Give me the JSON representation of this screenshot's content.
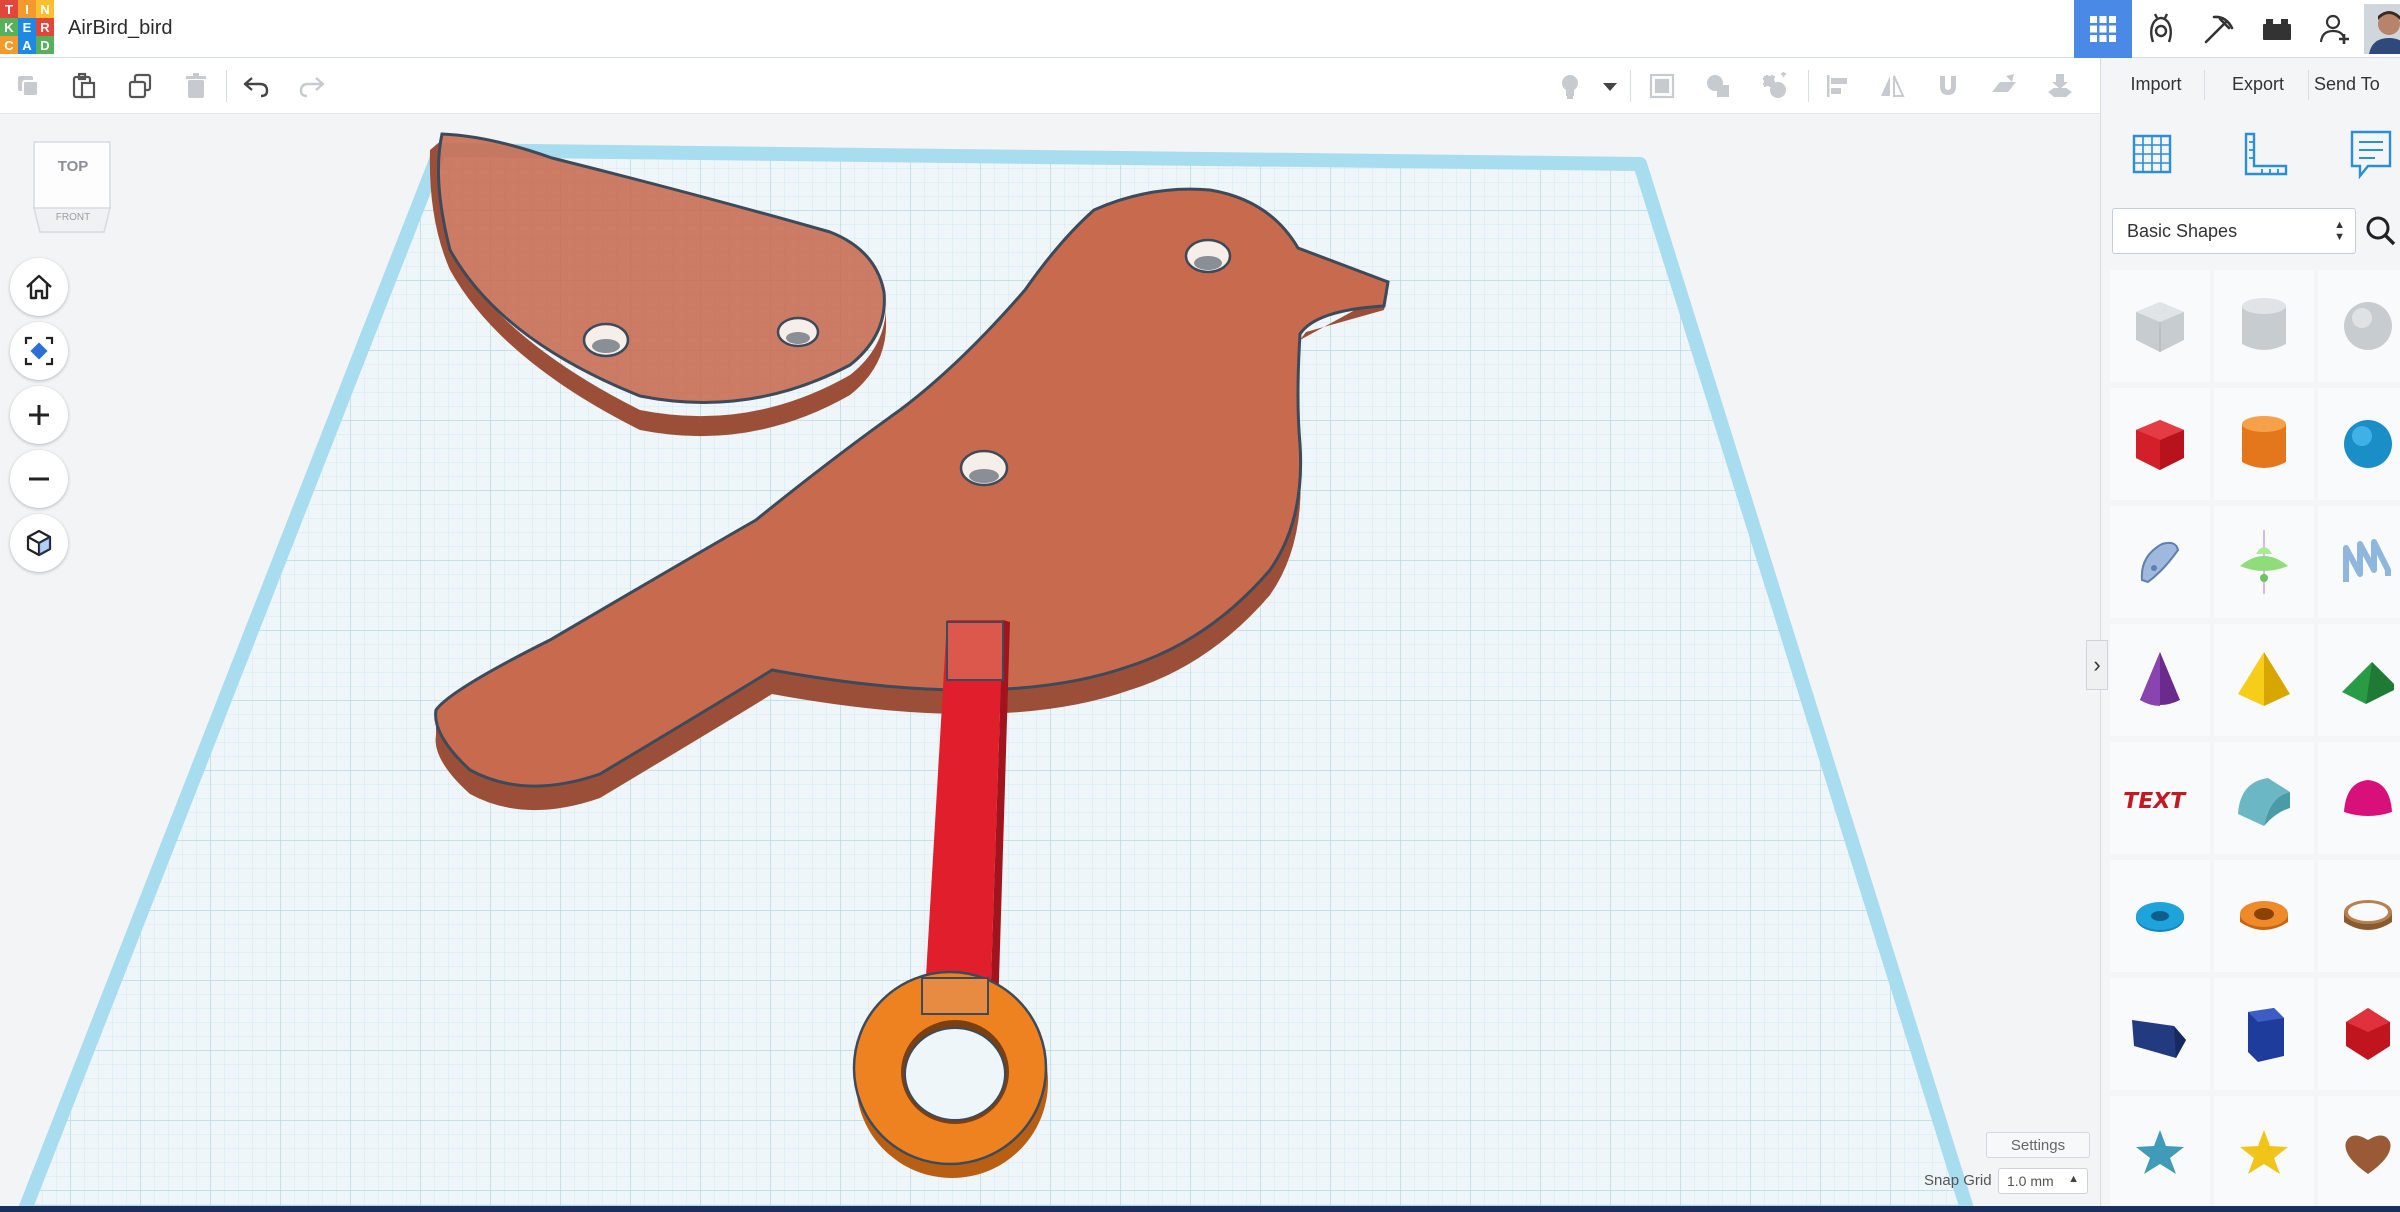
{
  "app": {
    "logo_letters": [
      "T",
      "I",
      "N",
      "K",
      "E",
      "R",
      "C",
      "A",
      "D"
    ],
    "logo_colors": [
      "#e2463a",
      "#f29a2e",
      "#fbc02d",
      "#57b05a",
      "#1e88e5",
      "#e2463a",
      "#f29a2e",
      "#1e88e5",
      "#57b05a"
    ],
    "project_title": "AirBird_bird"
  },
  "top_nav": {
    "icons": [
      "grid-view-icon",
      "tinker-gear-icon",
      "pickaxe-icon",
      "blocks-icon",
      "add-user-icon",
      "avatar"
    ],
    "active_color": "#4a8ae6"
  },
  "toolbar": {
    "left_icons": [
      "copy-icon",
      "paste-icon",
      "duplicate-icon",
      "delete-icon",
      "undo-icon",
      "redo-icon"
    ],
    "right_icons": [
      "light-bulb-icon",
      "dropdown-caret-icon",
      "group-icon",
      "ungroup-icon",
      "solid-hole-icon",
      "align-icon",
      "mirror-icon",
      "magnet-icon",
      "workplane-icon",
      "drop-icon"
    ]
  },
  "panel": {
    "import_label": "Import",
    "export_label": "Export",
    "send_to_label": "Send To",
    "shape_category": "Basic Shapes",
    "view_icons": [
      "workplane-grid-icon",
      "ruler-icon",
      "notes-icon"
    ]
  },
  "view_cube": {
    "top_label": "TOP",
    "front_label": "FRONT"
  },
  "view_controls": [
    "home-icon",
    "fit-icon",
    "zoom-in-icon",
    "zoom-out-icon",
    "perspective-icon"
  ],
  "footer": {
    "settings_label": "Settings",
    "snap_label": "Snap Grid",
    "snap_value": "1.0 mm"
  },
  "colors": {
    "bird": "#c76a4e",
    "stick": "#e11f2c",
    "ring": "#ee8220",
    "grid_edge": "#a8dcef"
  }
}
